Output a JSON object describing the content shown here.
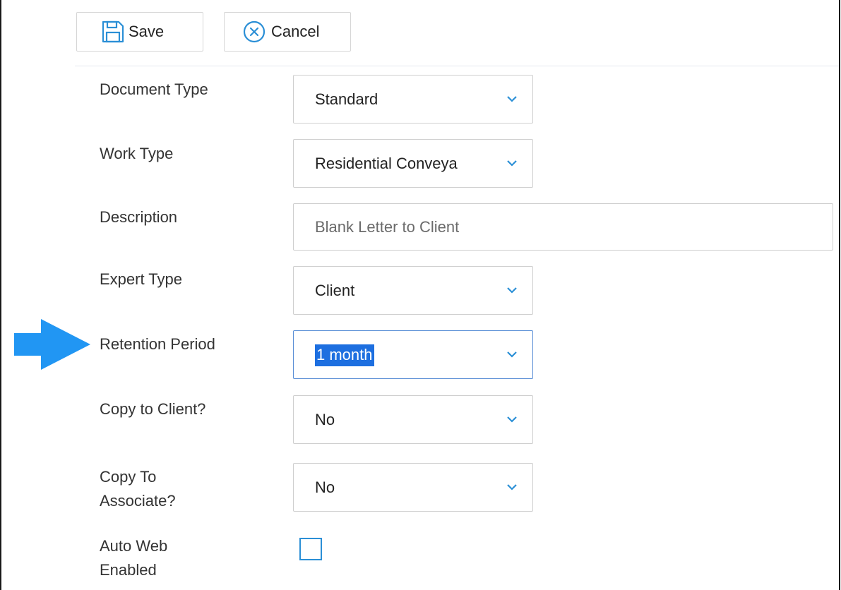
{
  "toolbar": {
    "save_label": "Save",
    "cancel_label": "Cancel",
    "save_icon": "save-icon",
    "cancel_icon": "cancel-circle-icon"
  },
  "form": {
    "document_type": {
      "label": "Document Type",
      "value": "Standard"
    },
    "work_type": {
      "label": "Work Type",
      "value": "Residential Conveya"
    },
    "description": {
      "label": "Description",
      "value": "Blank Letter to Client"
    },
    "expert_type": {
      "label": "Expert Type",
      "value": "Client"
    },
    "retention_period": {
      "label": "Retention Period",
      "value": "1 month",
      "focused": true
    },
    "copy_to_client": {
      "label": "Copy to Client?",
      "value": "No"
    },
    "copy_to_associate": {
      "label_line1": "Copy To",
      "label_line2": "Associate?",
      "value": "No"
    },
    "auto_web_enabled": {
      "label_line1": "Auto Web",
      "label_line2": "Enabled",
      "checked": false
    }
  },
  "colors": {
    "accent": "#2b8fd6",
    "arrow": "#2196f3",
    "selection": "#1d6fe0",
    "border": "#cfcfcf"
  }
}
